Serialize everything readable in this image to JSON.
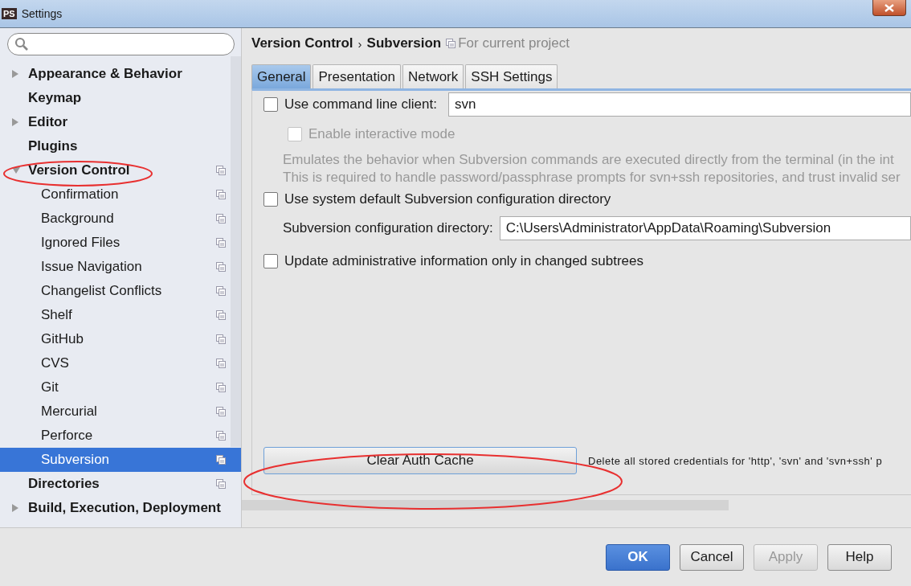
{
  "window": {
    "title": "Settings",
    "app_badge": "PS"
  },
  "sidebar": {
    "items": [
      {
        "label": "Appearance & Behavior",
        "expanded": false,
        "project_icon": false,
        "selected": false
      },
      {
        "label": "Keymap",
        "project_icon": false,
        "selected": false
      },
      {
        "label": "Editor",
        "expanded": false,
        "project_icon": false,
        "selected": false
      },
      {
        "label": "Plugins",
        "project_icon": false,
        "selected": false
      },
      {
        "label": "Version Control",
        "expanded": true,
        "project_icon": true,
        "selected": false,
        "children": [
          {
            "label": "Confirmation",
            "project_icon": true,
            "selected": false
          },
          {
            "label": "Background",
            "project_icon": true,
            "selected": false
          },
          {
            "label": "Ignored Files",
            "project_icon": true,
            "selected": false
          },
          {
            "label": "Issue Navigation",
            "project_icon": true,
            "selected": false
          },
          {
            "label": "Changelist Conflicts",
            "project_icon": true,
            "selected": false
          },
          {
            "label": "Shelf",
            "project_icon": true,
            "selected": false
          },
          {
            "label": "GitHub",
            "project_icon": true,
            "selected": false
          },
          {
            "label": "CVS",
            "project_icon": true,
            "selected": false
          },
          {
            "label": "Git",
            "project_icon": true,
            "selected": false
          },
          {
            "label": "Mercurial",
            "project_icon": true,
            "selected": false
          },
          {
            "label": "Perforce",
            "project_icon": true,
            "selected": false
          },
          {
            "label": "Subversion",
            "project_icon": true,
            "selected": true
          }
        ]
      },
      {
        "label": "Directories",
        "project_icon": true,
        "selected": false
      },
      {
        "label": "Build, Execution, Deployment",
        "expanded": false,
        "project_icon": false,
        "selected": false
      }
    ]
  },
  "breadcrumb": {
    "parent": "Version Control",
    "separator": "›",
    "current": "Subversion",
    "scope": "For current project"
  },
  "tabs": [
    {
      "label": "General",
      "selected": true
    },
    {
      "label": "Presentation",
      "selected": false
    },
    {
      "label": "Network",
      "selected": false
    },
    {
      "label": "SSH Settings",
      "selected": false
    }
  ],
  "general": {
    "command_line": {
      "label": "Use command line client:",
      "checked": false,
      "value": "svn"
    },
    "interactive": {
      "label": "Enable interactive mode",
      "checked": false,
      "disabled": true
    },
    "description": [
      "Emulates the behavior when Subversion commands are executed directly from the terminal (in the int",
      "This is required to handle password/passphrase prompts for svn+ssh repositories, and trust invalid ser"
    ],
    "system_default": {
      "label": "Use system default Subversion configuration directory",
      "checked": false
    },
    "config_dir": {
      "label": "Subversion configuration directory:",
      "value": "C:\\Users\\Administrator\\AppData\\Roaming\\Subversion"
    },
    "update_admin": {
      "label": "Update administrative information only in changed subtrees",
      "checked": false
    },
    "clear_button": "Clear Auth Cache",
    "clear_note": "Delete all stored credentials for 'http', 'svn' and 'svn+ssh' p"
  },
  "buttons": [
    {
      "label": "OK",
      "kind": "primary",
      "disabled": false
    },
    {
      "label": "Cancel",
      "kind": "normal",
      "disabled": false
    },
    {
      "label": "Apply",
      "kind": "normal",
      "disabled": true
    },
    {
      "label": "Help",
      "kind": "normal",
      "disabled": false
    }
  ]
}
